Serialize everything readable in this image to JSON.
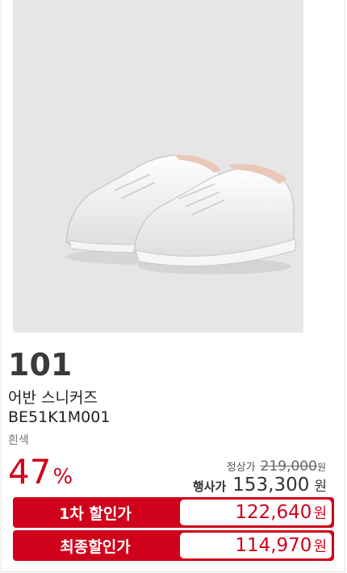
{
  "product": {
    "brand": "101",
    "name": "어반 스니커즈",
    "code": "BE51K1M001",
    "color": "흰색"
  },
  "pricing": {
    "discount_value": "47",
    "discount_unit": "%",
    "regular_label": "정상가",
    "regular_value": "219,000",
    "regular_unit": "원",
    "event_label": "행사가",
    "event_value": "153,300",
    "event_unit": "원",
    "first_label": "1차 할인가",
    "first_value": "122,640",
    "first_unit": "원",
    "final_label": "최종할인가",
    "final_value": "114,970",
    "final_unit": "원"
  },
  "colors": {
    "accent": "#d0021b",
    "photo_bg": "#e6e6e6"
  }
}
